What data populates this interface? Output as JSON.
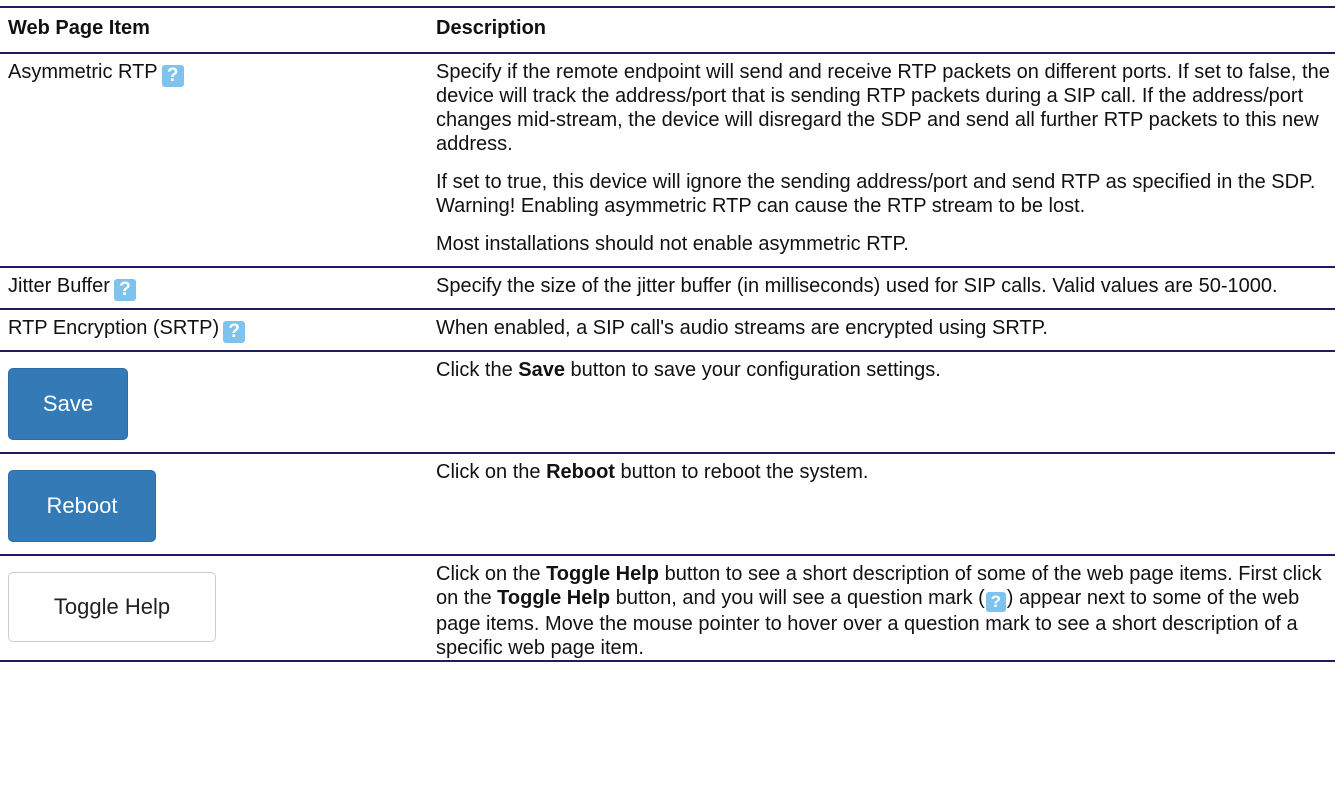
{
  "table": {
    "col_item": "Web Page Item",
    "col_desc": "Description",
    "rows": [
      {
        "item": "Asymmetric RTP",
        "desc": [
          "Specify if the remote endpoint will send and receive RTP packets on different ports. If set to false, the device will track the address/port that is sending RTP packets during a SIP call. If the address/port changes mid-stream, the device will disregard the SDP and send all further RTP packets to this new address.",
          "If set to true, this device will ignore the sending address/port and send RTP as specified in the SDP. Warning! Enabling asymmetric RTP can cause the RTP stream to be lost.",
          "Most installations should not enable asymmetric RTP."
        ]
      },
      {
        "item": "Jitter Buffer",
        "desc": [
          "Specify the size of the jitter buffer (in milliseconds) used for SIP calls. Valid values are 50-1000."
        ]
      },
      {
        "item": "RTP Encryption (SRTP)",
        "desc": [
          "When enabled, a SIP call's audio streams are encrypted using SRTP."
        ]
      }
    ],
    "help_glyph": "?",
    "save": {
      "label": "Save",
      "desc_pre": "Click the ",
      "desc_bold": "Save",
      "desc_post": " button to save your configuration settings."
    },
    "reboot": {
      "label": "Reboot",
      "desc_pre": "Click on the ",
      "desc_bold": "Reboot",
      "desc_post": " button to reboot the system."
    },
    "toggle": {
      "label": "Toggle Help",
      "d1": "Click on the ",
      "b1": "Toggle Help",
      "d2": " button to see a short description of some of the web page items. First click on the ",
      "b2": "Toggle Help",
      "d3": " button, and you will see a question mark (",
      "d4": ") appear next to some of the web page items. Move the mouse pointer to hover over a question mark to see a short description of a specific web page item."
    }
  }
}
